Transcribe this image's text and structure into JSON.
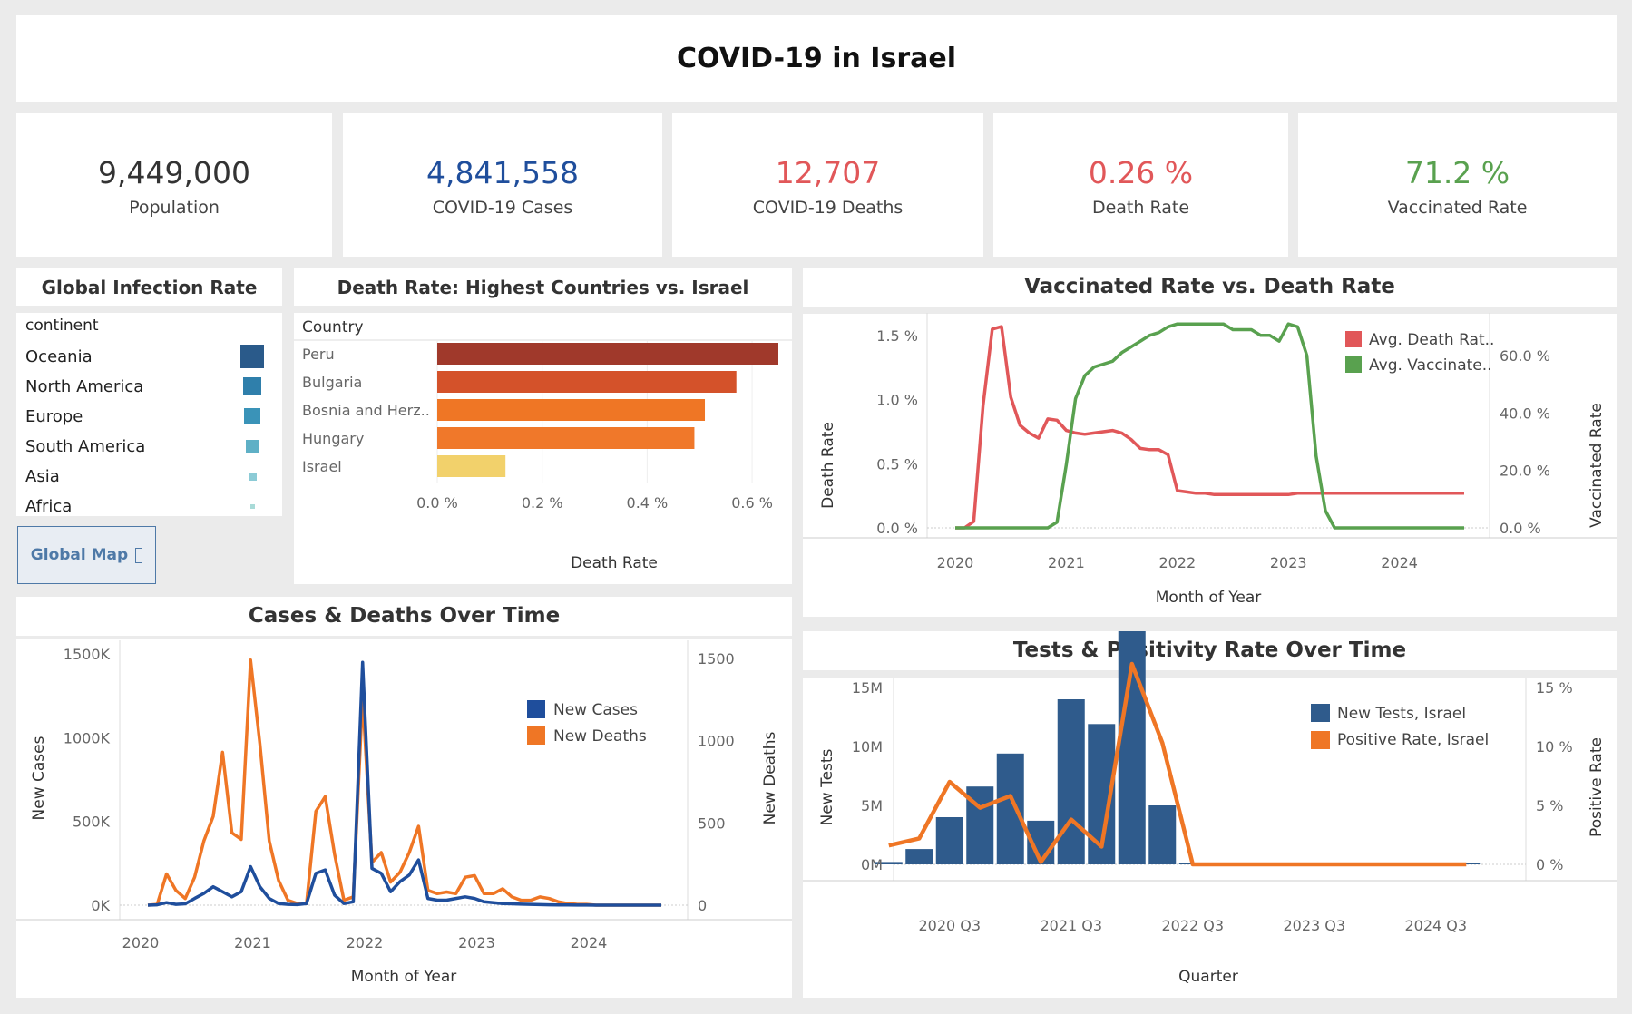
{
  "title": "COVID-19 in Israel",
  "kpis": [
    {
      "value": "9,449,000",
      "label": "Population",
      "color": "#333333"
    },
    {
      "value": "4,841,558",
      "label": "COVID-19 Cases",
      "color": "#1f4e9c"
    },
    {
      "value": "12,707",
      "label": "COVID-19 Deaths",
      "color": "#e15759"
    },
    {
      "value": "0.26 %",
      "label": "Death Rate",
      "color": "#e15759"
    },
    {
      "value": "71.2 %",
      "label": "Vaccinated Rate",
      "color": "#59a14f"
    }
  ],
  "infection": {
    "title": "Global Infection Rate",
    "header": "continent",
    "rows": [
      {
        "name": "Oceania",
        "color": "#2a5a8a"
      },
      {
        "name": "North America",
        "color": "#2f7fab"
      },
      {
        "name": "Europe",
        "color": "#3a93b8"
      },
      {
        "name": "South America",
        "color": "#5fb0c6"
      },
      {
        "name": "Asia",
        "color": "#8ccbd6"
      },
      {
        "name": "Africa",
        "color": "#a9dbd8"
      }
    ],
    "button_label": "Global Map",
    "button_icon": "external-link-icon"
  },
  "death_rate_chart": {
    "title": "Death Rate: Highest Countries vs. Israel",
    "header": "Country",
    "xlabel": "Death Rate",
    "ticks": [
      "0.0 %",
      "0.2 %",
      "0.4 %",
      "0.6 %"
    ]
  },
  "vacc_chart": {
    "title": "Vaccinated Rate vs. Death Rate",
    "xlabel": "Month of Year",
    "ylabel_left": "Death Rate",
    "ylabel_right": "Vaccinated Rate",
    "left_ticks": [
      "1.5 %",
      "1.0 %",
      "0.5 %",
      "0.0 %"
    ],
    "right_ticks": [
      "60.0 %",
      "40.0 %",
      "20.0 %",
      "0.0 %"
    ],
    "x_ticks": [
      "2020",
      "2021",
      "2022",
      "2023",
      "2024"
    ]
  },
  "cases_chart": {
    "title": "Cases & Deaths Over Time",
    "xlabel": "Month of Year",
    "ylabel_left": "New Cases",
    "ylabel_right": "New Deaths",
    "left_ticks": [
      "1500K",
      "1000K",
      "500K",
      "0K"
    ],
    "right_ticks": [
      "1500",
      "1000",
      "500",
      "0"
    ],
    "x_ticks": [
      "2020",
      "2021",
      "2022",
      "2023",
      "2024"
    ]
  },
  "tests_chart": {
    "title": "Tests & Positivity Rate Over Time",
    "xlabel": "Quarter",
    "ylabel_left": "New Tests",
    "ylabel_right": "Positive Rate",
    "left_ticks": [
      "15M",
      "10M",
      "5M",
      "0M"
    ],
    "right_ticks": [
      "15 %",
      "10 %",
      "5 %",
      "0 %"
    ],
    "x_ticks": [
      "2020 Q3",
      "2021 Q3",
      "2022 Q3",
      "2023 Q3",
      "2024 Q3"
    ]
  },
  "chart_data": [
    {
      "type": "bar",
      "categories": [
        "Peru",
        "Bulgaria",
        "Bosnia and Herz..",
        "Hungary",
        "Israel"
      ],
      "values": [
        0.65,
        0.57,
        0.51,
        0.49,
        0.13
      ],
      "colors": [
        "#a0392b",
        "#d4522a",
        "#ef7625",
        "#f0782a",
        "#f2d16b"
      ],
      "xlim": [
        0,
        0.65
      ],
      "unit": "%"
    },
    {
      "type": "line",
      "x": [
        "2020-01",
        "2020-02",
        "2020-03",
        "2020-04",
        "2020-05",
        "2020-06",
        "2020-07",
        "2020-08",
        "2020-09",
        "2020-10",
        "2020-11",
        "2020-12",
        "2021-01",
        "2021-02",
        "2021-03",
        "2021-04",
        "2021-05",
        "2021-06",
        "2021-07",
        "2021-08",
        "2021-09",
        "2021-10",
        "2021-11",
        "2021-12",
        "2022-01",
        "2022-02",
        "2022-03",
        "2022-04",
        "2022-05",
        "2022-06",
        "2022-07",
        "2022-08",
        "2022-09",
        "2022-10",
        "2022-11",
        "2022-12",
        "2023-01",
        "2023-02",
        "2023-03",
        "2023-04",
        "2023-05",
        "2023-06",
        "2023-07",
        "2023-08",
        "2023-09",
        "2023-10",
        "2023-11",
        "2023-12",
        "2024-01",
        "2024-02",
        "2024-03",
        "2024-04",
        "2024-05",
        "2024-06",
        "2024-07",
        "2024-08"
      ],
      "series": [
        {
          "name": "Avg. Death Rat..",
          "axis": "left",
          "color": "#e15759",
          "values": [
            0.0,
            0.0,
            0.05,
            0.95,
            1.55,
            1.57,
            1.02,
            0.8,
            0.74,
            0.7,
            0.85,
            0.84,
            0.76,
            0.74,
            0.73,
            0.74,
            0.75,
            0.76,
            0.74,
            0.69,
            0.62,
            0.61,
            0.61,
            0.57,
            0.29,
            0.28,
            0.27,
            0.27,
            0.26,
            0.26,
            0.26,
            0.26,
            0.26,
            0.26,
            0.26,
            0.26,
            0.26,
            0.27,
            0.27,
            0.27,
            0.27,
            0.27,
            0.27,
            0.27,
            0.27,
            0.27,
            0.27,
            0.27,
            0.27,
            0.27,
            0.27,
            0.27,
            0.27,
            0.27,
            0.27,
            0.27
          ]
        },
        {
          "name": "Avg. Vaccinate..",
          "axis": "right",
          "color": "#59a14f",
          "values": [
            0,
            0,
            0,
            0,
            0,
            0,
            0,
            0,
            0,
            0,
            0,
            2,
            22,
            45,
            53,
            56,
            57,
            58,
            61,
            63,
            65,
            67,
            68,
            70,
            71,
            71,
            71,
            71,
            71,
            71,
            69,
            69,
            69,
            67,
            67,
            65,
            71,
            70,
            60,
            25,
            6,
            0,
            0,
            0,
            0,
            0,
            0,
            0,
            0,
            0,
            0,
            0,
            0,
            0,
            0,
            0
          ]
        }
      ],
      "ylim_left": [
        0,
        1.6
      ],
      "ylim_right": [
        0,
        73
      ]
    },
    {
      "type": "line",
      "x": [
        "2020-01",
        "2020-02",
        "2020-03",
        "2020-04",
        "2020-05",
        "2020-06",
        "2020-07",
        "2020-08",
        "2020-09",
        "2020-10",
        "2020-11",
        "2020-12",
        "2021-01",
        "2021-02",
        "2021-03",
        "2021-04",
        "2021-05",
        "2021-06",
        "2021-07",
        "2021-08",
        "2021-09",
        "2021-10",
        "2021-11",
        "2021-12",
        "2022-01",
        "2022-02",
        "2022-03",
        "2022-04",
        "2022-05",
        "2022-06",
        "2022-07",
        "2022-08",
        "2022-09",
        "2022-10",
        "2022-11",
        "2022-12",
        "2023-01",
        "2023-02",
        "2023-03",
        "2023-04",
        "2023-05",
        "2023-06",
        "2023-07",
        "2023-08",
        "2023-09",
        "2023-10",
        "2023-11",
        "2023-12",
        "2024-01",
        "2024-02",
        "2024-03",
        "2024-04",
        "2024-05",
        "2024-06",
        "2024-07",
        "2024-08"
      ],
      "series": [
        {
          "name": "New Cases",
          "axis": "left",
          "color": "#1f4e9c",
          "values": [
            0,
            2000,
            15000,
            5000,
            8000,
            40000,
            70000,
            110000,
            80000,
            50000,
            80000,
            230000,
            110000,
            40000,
            10000,
            5000,
            3000,
            10000,
            190000,
            210000,
            60000,
            10000,
            20000,
            1450000,
            220000,
            190000,
            80000,
            140000,
            180000,
            270000,
            40000,
            30000,
            30000,
            40000,
            50000,
            40000,
            20000,
            15000,
            10000,
            8000,
            6000,
            5000,
            3000,
            2000,
            1000,
            1000,
            500,
            500,
            200,
            200,
            100,
            100,
            100,
            100,
            100,
            100
          ]
        },
        {
          "name": "New Deaths",
          "axis": "right",
          "color": "#ef7625",
          "values": [
            0,
            5,
            190,
            90,
            40,
            170,
            390,
            540,
            930,
            440,
            400,
            1490,
            980,
            390,
            150,
            30,
            10,
            10,
            570,
            660,
            310,
            30,
            50,
            1270,
            260,
            320,
            140,
            200,
            320,
            480,
            90,
            70,
            80,
            70,
            170,
            180,
            70,
            70,
            100,
            50,
            30,
            30,
            50,
            40,
            20,
            10,
            5,
            5,
            0,
            0,
            0,
            0,
            0,
            0,
            0,
            0
          ]
        }
      ],
      "ylim_left": [
        0,
        1550000
      ],
      "ylim_right": [
        0,
        1550
      ]
    },
    {
      "type": "bar",
      "categories": [
        "2020 Q1",
        "2020 Q2",
        "2020 Q3",
        "2020 Q4",
        "2021 Q1",
        "2021 Q2",
        "2021 Q3",
        "2021 Q4",
        "2022 Q1",
        "2022 Q2",
        "2022 Q3",
        "2022 Q4",
        "2023 Q1",
        "2023 Q2",
        "2023 Q3",
        "2023 Q4",
        "2024 Q1",
        "2024 Q2",
        "2024 Q3",
        "2024 Q4"
      ],
      "series": [
        {
          "name": "New Tests, Israel",
          "type": "bar",
          "axis": "left",
          "color": "#2f5b8c",
          "values": [
            200000,
            1300000,
            4000000,
            6600000,
            9400000,
            3700000,
            14000000,
            11900000,
            22400000,
            5000000,
            100000,
            0,
            0,
            0,
            0,
            0,
            0,
            0,
            0,
            100000
          ]
        },
        {
          "name": "Positive Rate, Israel",
          "type": "line",
          "axis": "right",
          "color": "#ef7625",
          "values": [
            1.6,
            2.2,
            7.0,
            4.8,
            5.8,
            0.2,
            3.8,
            1.5,
            17.0,
            10.3,
            0.0,
            0.0,
            0.0,
            0.0,
            0.0,
            0.0,
            0.0,
            0.0,
            0.0,
            0.0
          ]
        }
      ],
      "ylim_left": [
        0,
        22600000
      ],
      "ylim_right": [
        0,
        17.0
      ]
    }
  ]
}
